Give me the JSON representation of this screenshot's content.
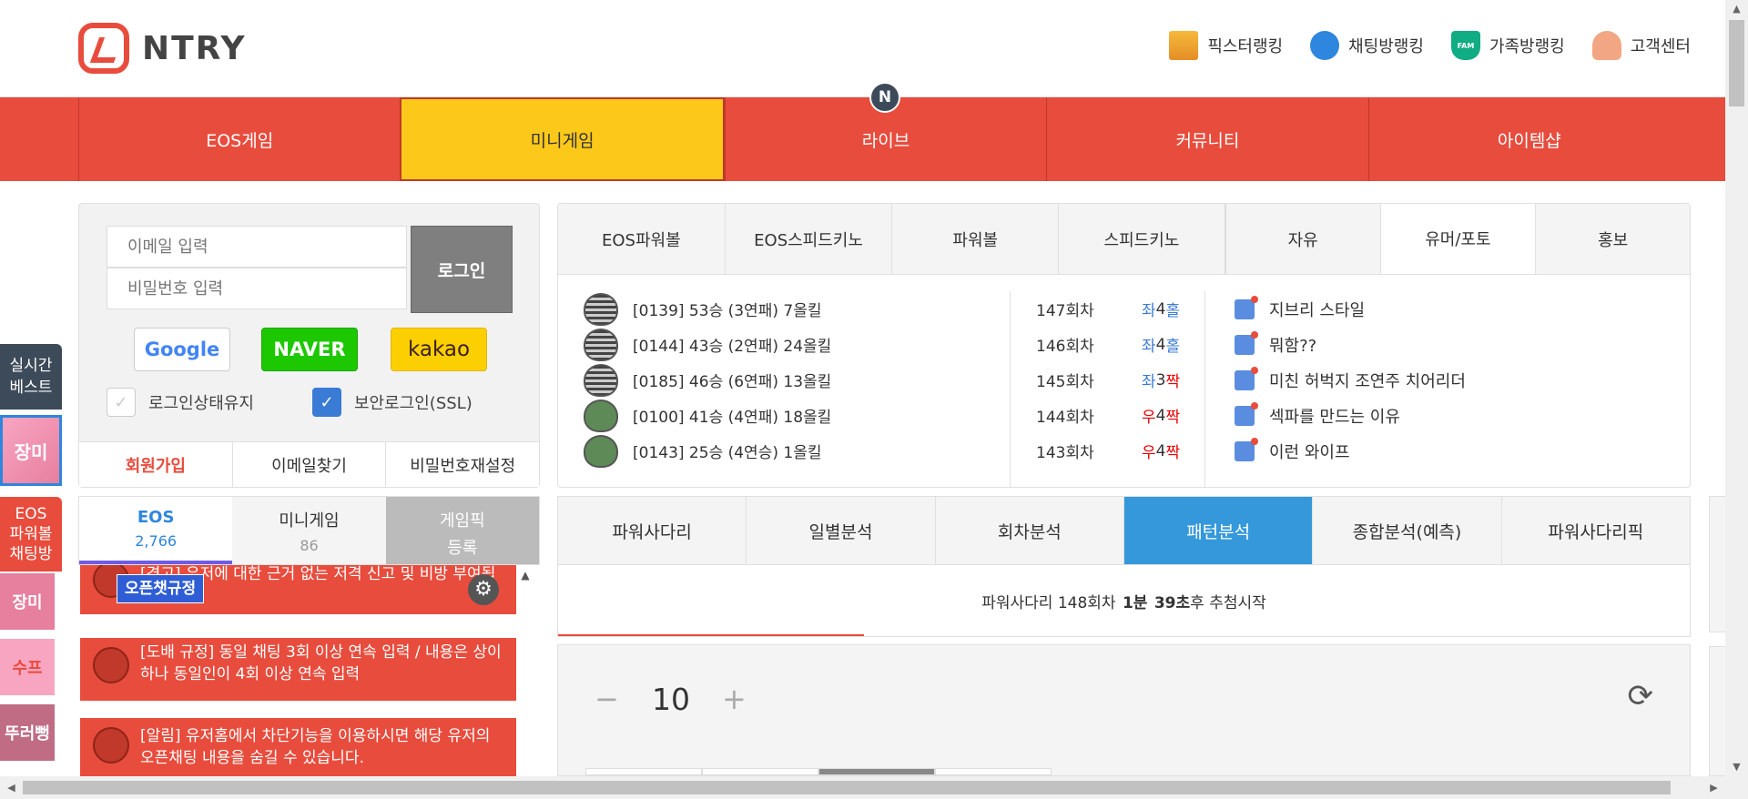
{
  "header": {
    "logo_text": "NTRY",
    "links": [
      {
        "label": "픽스터랭킹",
        "icon": "trophy-icon"
      },
      {
        "label": "채팅방랭킹",
        "icon": "chat-bubble-icon"
      },
      {
        "label": "가족방랭킹",
        "icon": "family-badge-icon"
      },
      {
        "label": "고객센터",
        "icon": "customer-service-icon"
      }
    ],
    "fam_text": "FAM"
  },
  "nav": {
    "items": [
      "EOS게임",
      "미니게임",
      "라이브",
      "커뮤니티",
      "아이템샵"
    ],
    "active_index": 1,
    "badge": "N"
  },
  "left_float": {
    "realtime_best": "실시간\n베스트",
    "thumb1": "장미",
    "eos_room": "EOS\n파워볼\n채팅방",
    "thumbs": [
      "장미",
      "수프",
      "뚜러뻥"
    ]
  },
  "login": {
    "email_placeholder": "이메일 입력",
    "password_placeholder": "비밀번호 입력",
    "login_button": "로그인",
    "google": "Google",
    "naver": "NAVER",
    "kakao": "kakao",
    "keep_login": "로그인상태유지",
    "secure_login": "보안로그인(SSL)",
    "signup": "회원가입",
    "find_email": "이메일찾기",
    "reset_password": "비밀번호재설정"
  },
  "chat": {
    "tabs": [
      {
        "label": "EOS",
        "count": "2,766"
      },
      {
        "label": "미니게임",
        "count": "86"
      },
      {
        "label": "게임픽",
        "count": "등록"
      }
    ],
    "messages": [
      "[경고] 유저에 대한 근거 없는 저격 신고 및 비방 부여됩니다.",
      "[도배 규정] 동일 채팅 3회 이상 연속 입력 / 내용은 상이하나 동일인이 4회 이상 연속 입력",
      "[알림] 유저홈에서 차단기능을 이용하시면 해당 유저의 오픈채팅 내용을 숨길 수 있습니다."
    ],
    "rules_badge": "오픈챗규정"
  },
  "board": {
    "tabs": [
      "EOS파워볼",
      "EOS스피드키노",
      "파워볼",
      "스피드키노",
      "자유",
      "유머/포토",
      "홍보"
    ],
    "active_tab": 5,
    "games": [
      {
        "text": "[0139] 53승 (3연패) 7올킬",
        "avatar": "hat"
      },
      {
        "text": "[0144] 43승 (2연패) 24올킬",
        "avatar": "hat"
      },
      {
        "text": "[0185] 46승 (6연패) 13올킬",
        "avatar": "hat"
      },
      {
        "text": "[0100] 41승 (4연패) 18올킬",
        "avatar": "green"
      },
      {
        "text": "[0143] 25승 (4연승) 1올킬",
        "avatar": "green"
      }
    ],
    "results": [
      {
        "round": "147회차",
        "side": "좌",
        "num": "4",
        "oe": "홀",
        "side_color": "blue",
        "oe_color": "blue"
      },
      {
        "round": "146회차",
        "side": "좌",
        "num": "4",
        "oe": "홀",
        "side_color": "blue",
        "oe_color": "blue"
      },
      {
        "round": "145회차",
        "side": "좌",
        "num": "3",
        "oe": "짝",
        "side_color": "blue",
        "oe_color": "red"
      },
      {
        "round": "144회차",
        "side": "우",
        "num": "4",
        "oe": "짝",
        "side_color": "red",
        "oe_color": "red"
      },
      {
        "round": "143회차",
        "side": "우",
        "num": "4",
        "oe": "짝",
        "side_color": "red",
        "oe_color": "red"
      }
    ],
    "posts": [
      "지브리 스타일",
      "뭐함??",
      "미친 허벅지 조연주 치어리더",
      "섹파를 만드는 이유",
      "이런 와이프"
    ]
  },
  "analysis": {
    "tabs": [
      "파워사다리",
      "일별분석",
      "회차분석",
      "패턴분석",
      "종합분석(예측)",
      "파워사다리픽"
    ],
    "active_tab": 3,
    "countdown_prefix": "파워사다리 148회차",
    "countdown_min": "1분",
    "countdown_sec": "39초",
    "countdown_suffix": "후 추첨시작",
    "countdown_progress": 0.27,
    "stepper_value": "10",
    "stepper_minus": "−",
    "stepper_plus": "+"
  },
  "colors": {
    "primary": "#e84c3d",
    "active_nav": "#fcc91a",
    "active_analysis": "#3498db"
  }
}
